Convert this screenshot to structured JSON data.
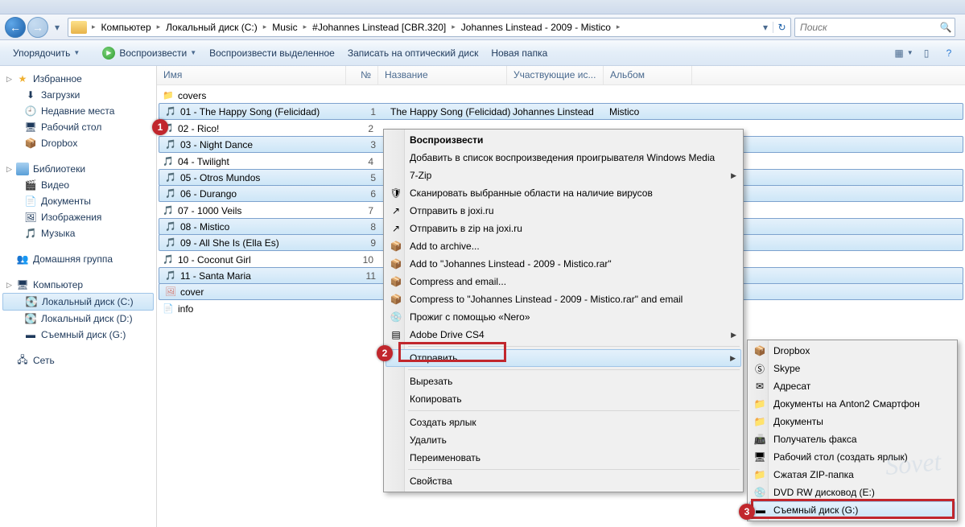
{
  "nav": {
    "crumbs": [
      "Компьютер",
      "Локальный диск (C:)",
      "Music",
      "#Johannes Linstead [CBR.320]",
      "Johannes Linstead - 2009 - Mistico"
    ],
    "search_placeholder": "Поиск"
  },
  "toolbar": {
    "organize": "Упорядочить",
    "play": "Воспроизвести",
    "play_sel": "Воспроизвести выделенное",
    "burn": "Записать на оптический диск",
    "new_folder": "Новая папка"
  },
  "sidebar": {
    "fav": "Избранное",
    "fav_items": [
      "Загрузки",
      "Недавние места",
      "Рабочий стол",
      "Dropbox"
    ],
    "lib": "Библиотеки",
    "lib_items": [
      "Видео",
      "Документы",
      "Изображения",
      "Музыка"
    ],
    "home": "Домашняя группа",
    "comp": "Компьютер",
    "comp_items": [
      "Локальный диск (C:)",
      "Локальный диск (D:)",
      "Съемный диск (G:)"
    ],
    "net": "Сеть"
  },
  "cols": {
    "name": "Имя",
    "num": "№",
    "title": "Название",
    "artist": "Участвующие ис...",
    "album": "Альбом"
  },
  "files": [
    {
      "name": "covers",
      "type": "folder"
    },
    {
      "name": "01 - The Happy Song (Felicidad)",
      "num": "1",
      "title": "The Happy Song (Felicidad)",
      "artist": "Johannes Linstead",
      "album": "Mistico",
      "sel": true
    },
    {
      "name": "02 - Rico!",
      "num": "2",
      "sel": false
    },
    {
      "name": "03 - Night Dance",
      "num": "3",
      "sel": true
    },
    {
      "name": "04 - Twilight",
      "num": "4",
      "sel": false
    },
    {
      "name": "05 - Otros Mundos",
      "num": "5",
      "sel": true
    },
    {
      "name": "06 - Durango",
      "num": "6",
      "sel": true
    },
    {
      "name": "07 - 1000 Veils",
      "num": "7",
      "sel": false
    },
    {
      "name": "08 - Mistico",
      "num": "8",
      "sel": true
    },
    {
      "name": "09 - All She Is (Ella Es)",
      "num": "9",
      "sel": true
    },
    {
      "name": "10 - Coconut Girl",
      "num": "10",
      "sel": false
    },
    {
      "name": "11 - Santa Maria",
      "num": "11",
      "sel": true
    },
    {
      "name": "cover",
      "type": "jpg",
      "sel": true
    },
    {
      "name": "info",
      "type": "txt",
      "sel": false
    }
  ],
  "ctx1": [
    {
      "t": "Воспроизвести",
      "bold": true
    },
    {
      "t": "Добавить в список воспроизведения проигрывателя Windows Media"
    },
    {
      "t": "7-Zip",
      "sub": true
    },
    {
      "t": "Сканировать выбранные области на наличие вирусов",
      "ico": "🛡"
    },
    {
      "t": "Отправить в joxi.ru",
      "ico": "↗"
    },
    {
      "t": "Отправить в zip на joxi.ru",
      "ico": "↗"
    },
    {
      "t": "Add to archive...",
      "ico": "📦"
    },
    {
      "t": "Add to \"Johannes Linstead - 2009 - Mistico.rar\"",
      "ico": "📦"
    },
    {
      "t": "Compress and email...",
      "ico": "📦"
    },
    {
      "t": "Compress to \"Johannes Linstead - 2009 - Mistico.rar\" and email",
      "ico": "📦"
    },
    {
      "t": "Прожиг с помощью «Nero»",
      "ico": "💿"
    },
    {
      "t": "Adobe Drive CS4",
      "ico": "▤",
      "sub": true
    },
    {
      "sep": true
    },
    {
      "t": "Отправить",
      "sub": true,
      "hl": true
    },
    {
      "sep": true
    },
    {
      "t": "Вырезать"
    },
    {
      "t": "Копировать"
    },
    {
      "sep": true
    },
    {
      "t": "Создать ярлык"
    },
    {
      "t": "Удалить"
    },
    {
      "t": "Переименовать"
    },
    {
      "sep": true
    },
    {
      "t": "Свойства"
    }
  ],
  "ctx2": [
    {
      "t": "Dropbox",
      "ico": "📦"
    },
    {
      "t": "Skype",
      "ico": "Ⓢ"
    },
    {
      "t": "Адресат",
      "ico": "✉"
    },
    {
      "t": "Документы на Anton2 Смартфон",
      "ico": "📁"
    },
    {
      "t": "Документы",
      "ico": "📁"
    },
    {
      "t": "Получатель факса",
      "ico": "📠"
    },
    {
      "t": "Рабочий стол (создать ярлык)",
      "ico": "🖥"
    },
    {
      "t": "Сжатая ZIP-папка",
      "ico": "📁"
    },
    {
      "t": "DVD RW дисковод (E:)",
      "ico": "💿"
    },
    {
      "t": "Съемный диск (G:)",
      "ico": "▬",
      "hl": true
    }
  ],
  "badges": {
    "b1": "1",
    "b2": "2",
    "b3": "3"
  }
}
